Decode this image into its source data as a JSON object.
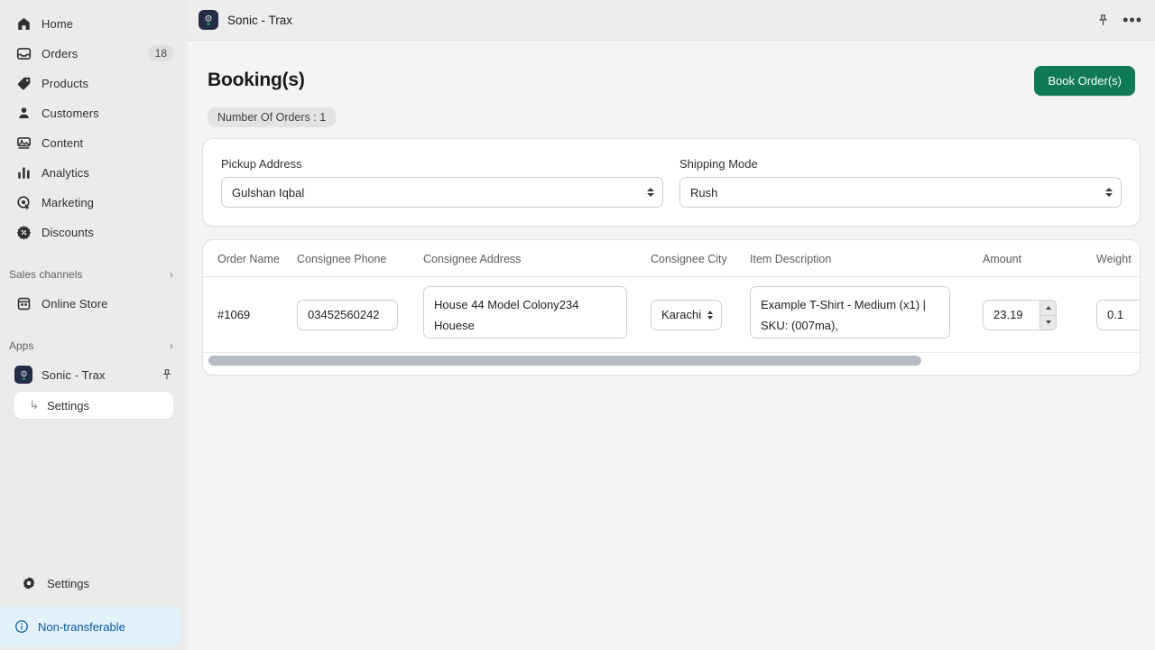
{
  "sidebar": {
    "nav": [
      {
        "label": "Home",
        "icon": "home-icon",
        "count": ""
      },
      {
        "label": "Orders",
        "icon": "orders-icon",
        "count": "18"
      },
      {
        "label": "Products",
        "icon": "products-icon",
        "count": ""
      },
      {
        "label": "Customers",
        "icon": "customers-icon",
        "count": ""
      },
      {
        "label": "Content",
        "icon": "content-icon",
        "count": ""
      },
      {
        "label": "Analytics",
        "icon": "analytics-icon",
        "count": ""
      },
      {
        "label": "Marketing",
        "icon": "marketing-icon",
        "count": ""
      },
      {
        "label": "Discounts",
        "icon": "discounts-icon",
        "count": ""
      }
    ],
    "sales_channels": {
      "label": "Sales channels",
      "chevron": "›"
    },
    "online_store": {
      "label": "Online Store",
      "icon": "store-icon"
    },
    "apps": {
      "label": "Apps",
      "chevron": "›"
    },
    "app_entry": {
      "label": "Sonic - Trax",
      "icon": "sonic-trax-app-icon",
      "pin": "pin-icon"
    },
    "app_sub": {
      "label": "Settings",
      "arrow": "↳"
    },
    "settings_bottom": {
      "label": "Settings",
      "icon": "gear-icon"
    },
    "non_transferable": {
      "label": "Non-transferable",
      "icon": "info-icon",
      "bg": "#e3f1fb",
      "fg": "#0a58a2"
    }
  },
  "topbar": {
    "title": "Sonic - Trax",
    "app_icon": "sonic-trax-app-icon",
    "pin_icon": "pin-icon",
    "more_icon": "more-horizontal-icon",
    "more_glyph": "•••"
  },
  "page": {
    "title": "Booking(s)",
    "primary_button": "Book Order(s)",
    "primary_color": "#0f7a55",
    "orders_chip": "Number Of Orders : 1"
  },
  "form": {
    "pickup": {
      "label": "Pickup Address",
      "value": "Gulshan Iqbal"
    },
    "shipping": {
      "label": "Shipping Mode",
      "value": "Rush"
    }
  },
  "table": {
    "columns": [
      "Order Name",
      "Consignee Phone",
      "Consignee Address",
      "Consignee City",
      "Item Description",
      "Amount",
      "Weight"
    ],
    "rows": [
      {
        "order_name": "#1069",
        "consignee_phone": "03452560242",
        "consignee_address": "House 44 Model Colony234 Houese",
        "consignee_city": "Karachi",
        "item_description": "Example T-Shirt - Medium (x1) | SKU: (007ma),",
        "amount": "23.19",
        "weight": "0.1"
      }
    ]
  }
}
